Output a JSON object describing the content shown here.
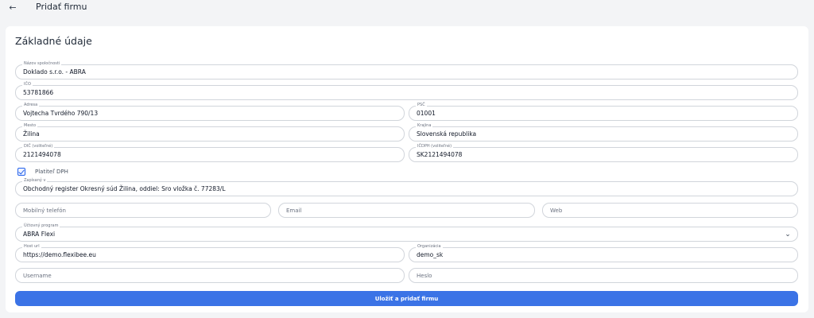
{
  "header": {
    "title": "Pridať firmu",
    "back_icon": "arrow-left-icon"
  },
  "section_title": "Základné údaje",
  "fields": {
    "company_name": {
      "label": "Názov spoločnosti",
      "value": "Doklado s.r.o. - ABRA"
    },
    "ico": {
      "label": "IČO",
      "value": "53781866"
    },
    "address": {
      "label": "Adresa",
      "value": "Vojtecha Tvrdého 790/13"
    },
    "psc": {
      "label": "PSČ",
      "value": "01001"
    },
    "city": {
      "label": "Mesto",
      "value": "Žilina"
    },
    "country": {
      "label": "Krajina",
      "value": "Slovenská republika"
    },
    "dic": {
      "label": "DIČ (voliteľné)",
      "value": "2121494078"
    },
    "icdph": {
      "label": "IČDPH (voliteľné)",
      "value": "SK2121494078"
    },
    "registered": {
      "label": "Zapísaný v",
      "value": "Obchodný register Okresný súd Žilina, oddiel: Sro vložka č. 77283/L"
    },
    "mobile": {
      "placeholder": "Mobilný telefón"
    },
    "email": {
      "placeholder": "Email"
    },
    "web": {
      "placeholder": "Web"
    },
    "accounting_program": {
      "label": "Účtovný program",
      "value": "ABRA Flexi"
    },
    "host_url": {
      "label": "Host url",
      "value": "https://demo.flexibee.eu"
    },
    "organization": {
      "label": "Organizácia",
      "value": "demo_sk"
    },
    "username": {
      "placeholder": "Username"
    },
    "password": {
      "placeholder": "Heslo"
    }
  },
  "vat_payer": {
    "label": "Platiteľ DPH",
    "checked": true
  },
  "submit_label": "Uložiť a pridať firmu",
  "colors": {
    "accent": "#3b73e6",
    "background": "#f3f4f6"
  }
}
